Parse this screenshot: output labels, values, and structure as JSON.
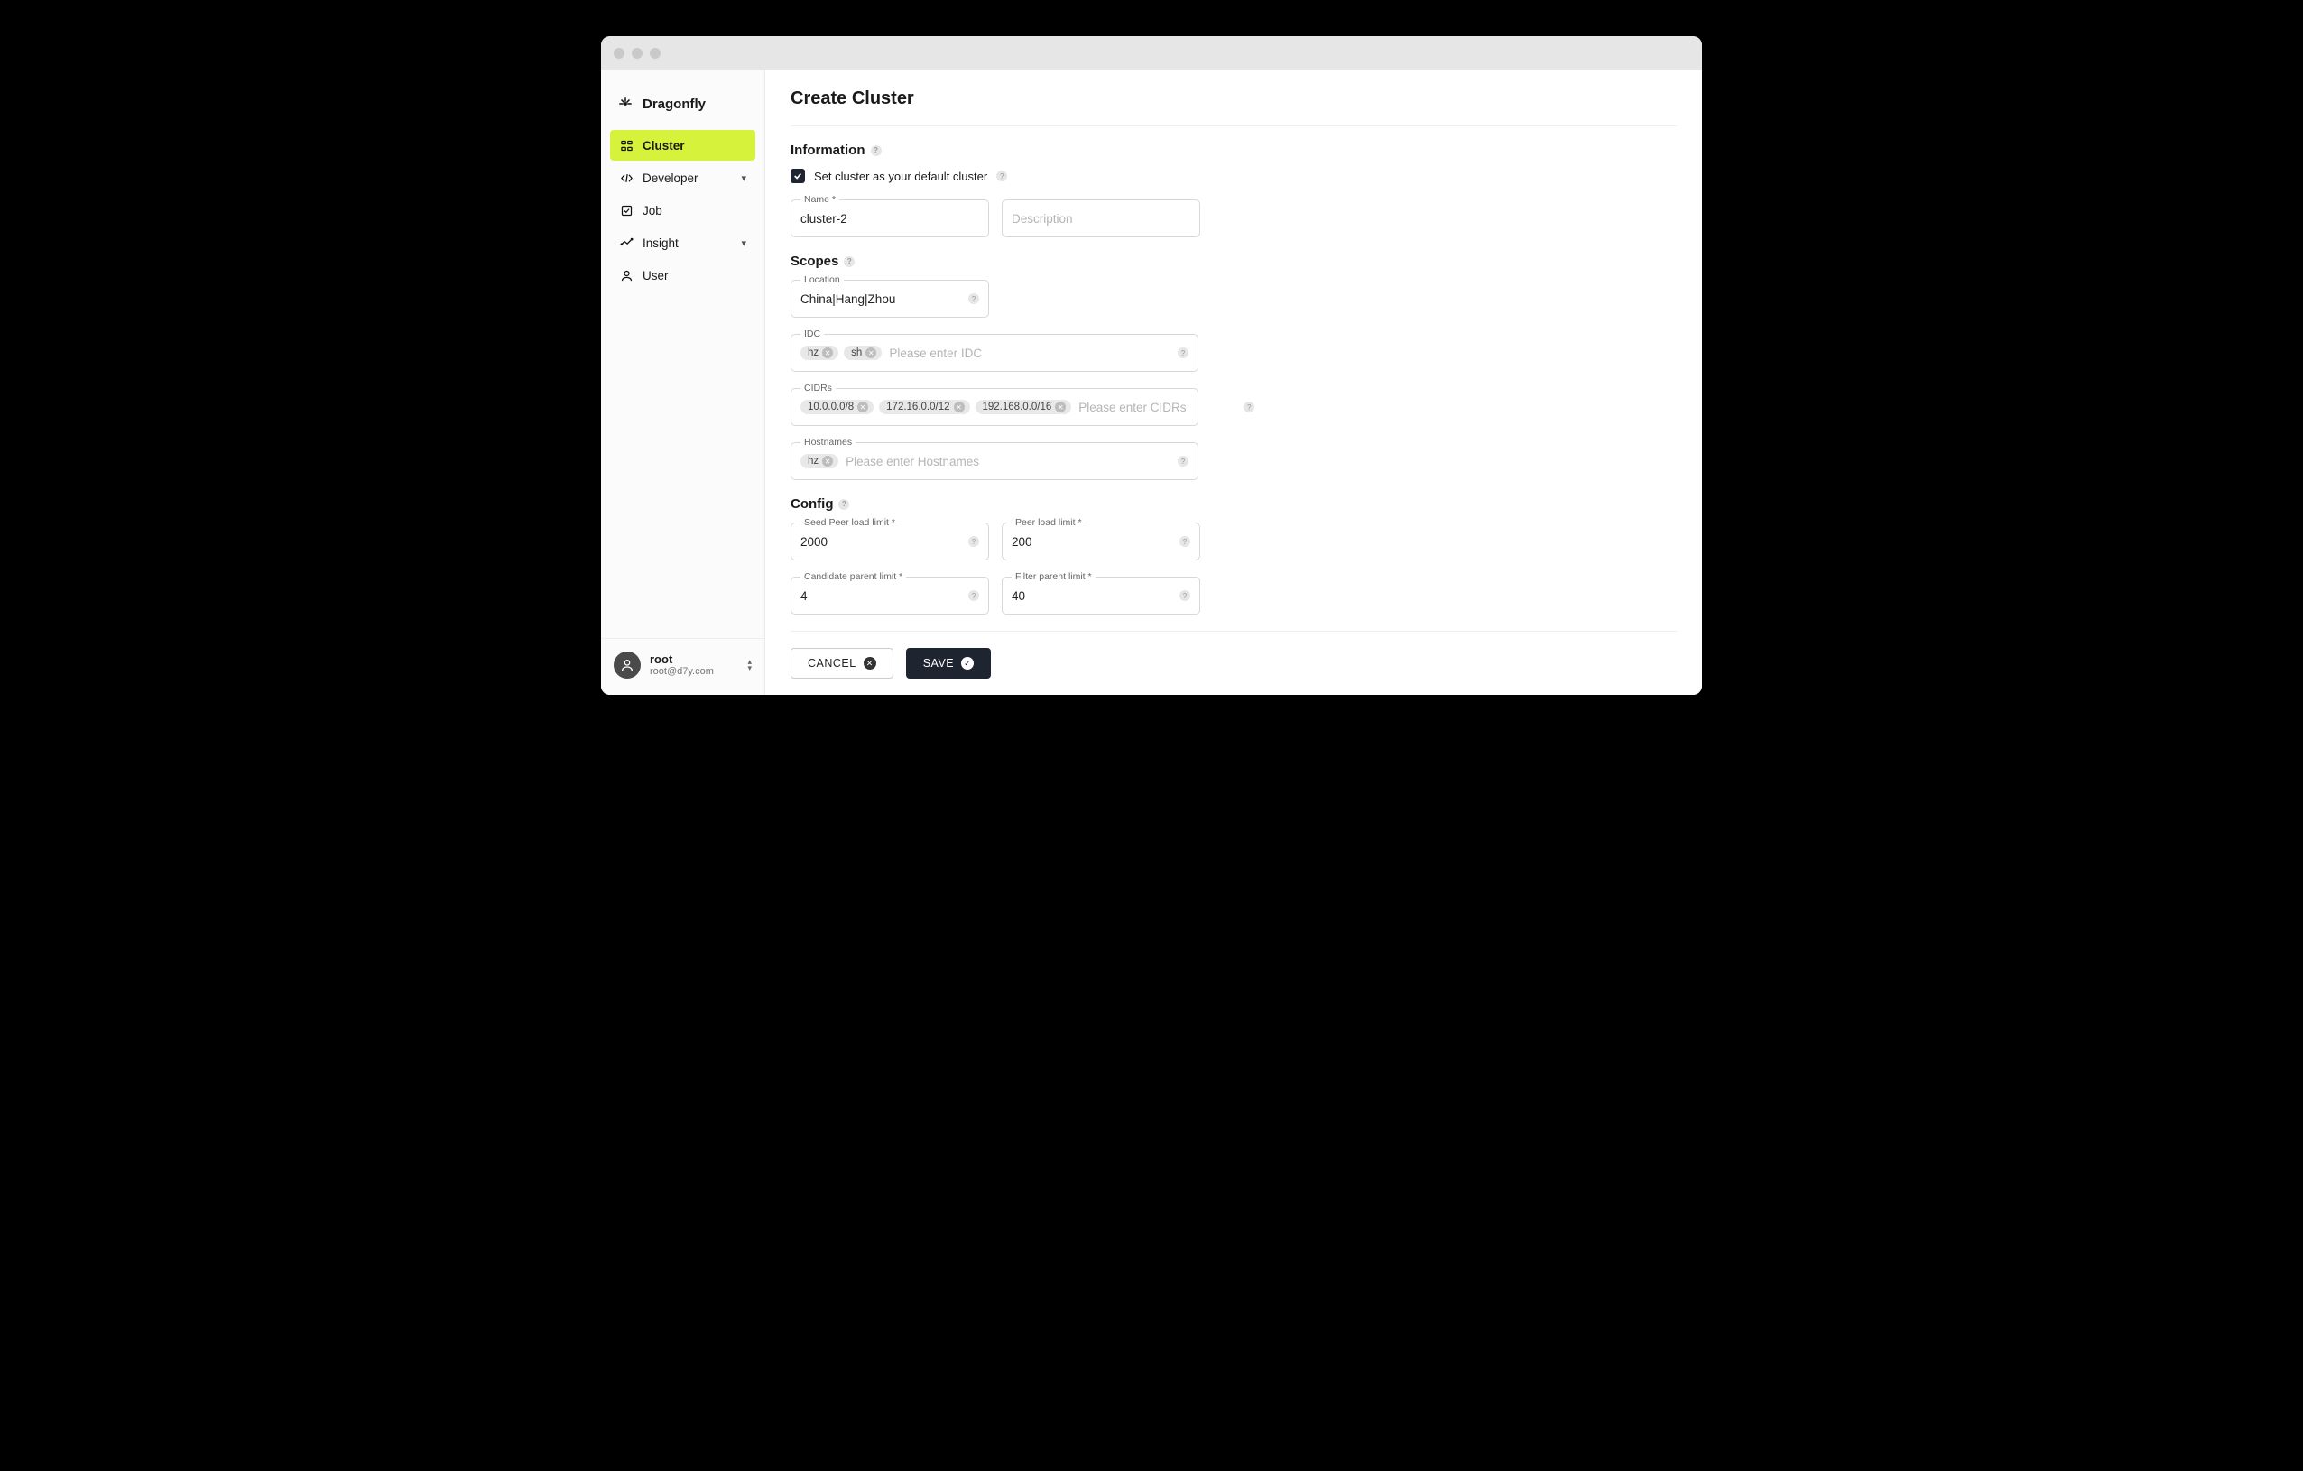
{
  "brand": {
    "name": "Dragonfly"
  },
  "sidebar": {
    "items": [
      {
        "label": "Cluster",
        "icon": "cluster-icon",
        "active": true,
        "expandable": false
      },
      {
        "label": "Developer",
        "icon": "code-icon",
        "active": false,
        "expandable": true
      },
      {
        "label": "Job",
        "icon": "job-icon",
        "active": false,
        "expandable": false
      },
      {
        "label": "Insight",
        "icon": "insight-icon",
        "active": false,
        "expandable": true
      },
      {
        "label": "User",
        "icon": "user-icon",
        "active": false,
        "expandable": false
      }
    ]
  },
  "user": {
    "name": "root",
    "email": "root@d7y.com"
  },
  "page": {
    "title": "Create Cluster",
    "sections": {
      "information": {
        "title": "Information",
        "default_checkbox_label": "Set cluster as your default cluster",
        "default_checked": true,
        "name": {
          "label": "Name *",
          "value": "cluster-2"
        },
        "description": {
          "label": "",
          "placeholder": "Description",
          "value": ""
        }
      },
      "scopes": {
        "title": "Scopes",
        "location": {
          "label": "Location",
          "value": "China|Hang|Zhou"
        },
        "idc": {
          "label": "IDC",
          "placeholder": "Please enter IDC",
          "chips": [
            "hz",
            "sh"
          ]
        },
        "cidrs": {
          "label": "CIDRs",
          "placeholder": "Please enter CIDRs",
          "chips": [
            "10.0.0.0/8",
            "172.16.0.0/12",
            "192.168.0.0/16"
          ]
        },
        "hostnames": {
          "label": "Hostnames",
          "placeholder": "Please enter Hostnames",
          "chips": [
            "hz"
          ]
        }
      },
      "config": {
        "title": "Config",
        "seed_peer_load_limit": {
          "label": "Seed Peer load limit *",
          "value": "2000"
        },
        "peer_load_limit": {
          "label": "Peer load limit *",
          "value": "200"
        },
        "candidate_parent_limit": {
          "label": "Candidate parent limit *",
          "value": "4"
        },
        "filter_parent_limit": {
          "label": "Filter parent limit *",
          "value": "40"
        }
      }
    },
    "actions": {
      "cancel": "CANCEL",
      "save": "SAVE"
    }
  },
  "colors": {
    "accent": "#d6f23a",
    "dark": "#1e2430"
  }
}
